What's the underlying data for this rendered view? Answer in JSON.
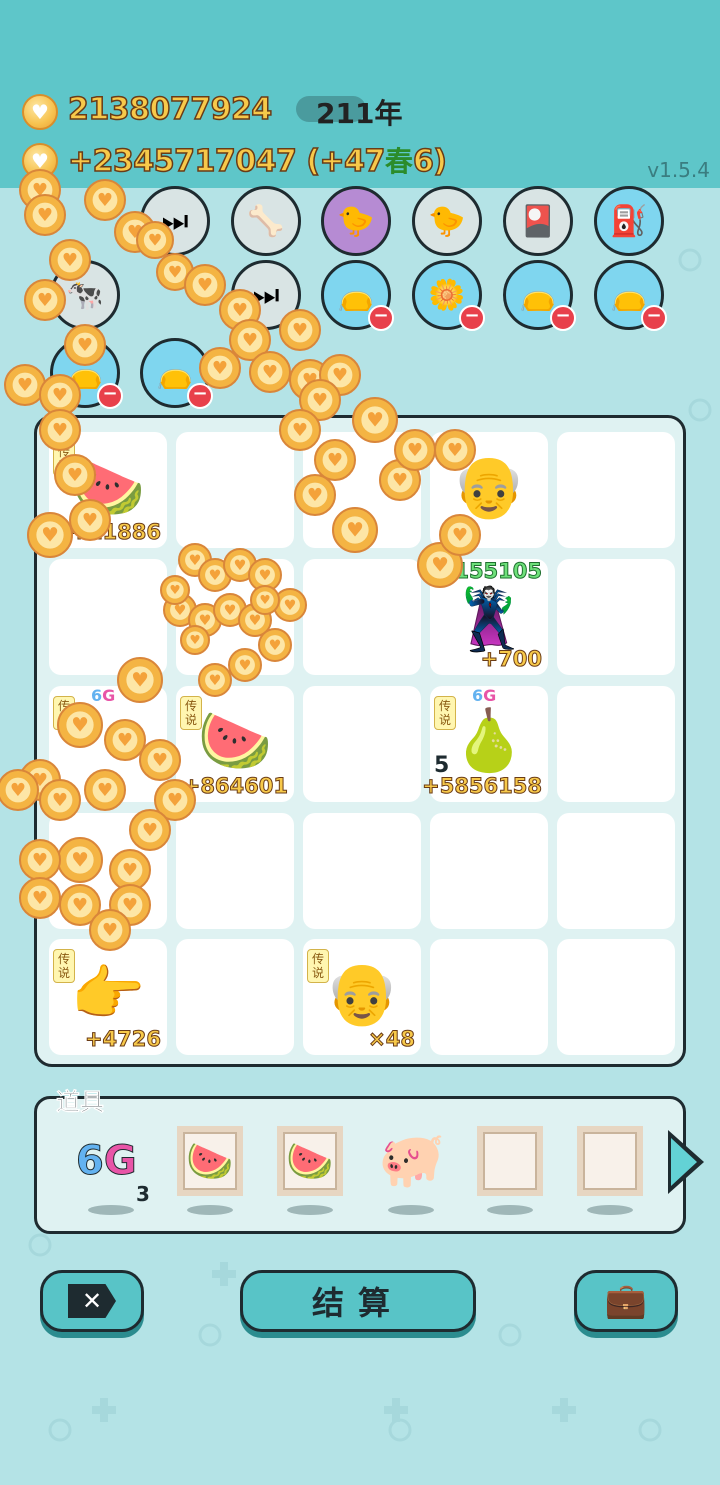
{
  "header": {
    "money": "2138077924",
    "income": "+2345717047 (+47",
    "income_tail": "6)",
    "year": "211年",
    "season": "春",
    "version": "v1.5.4"
  },
  "top_items": [
    {
      "icon": "pump-icon",
      "glyph": "⇡"
    },
    {
      "icon": "seed-bag-icon",
      "glyph": "▣"
    }
  ],
  "board": {
    "cells": [
      {
        "name": "cell-watermelon-1",
        "tag": "传说",
        "value": "+11886",
        "glyph": "🍉"
      },
      {
        "name": "cell-farmer",
        "value": "",
        "glyph": "👴"
      },
      {
        "name": "cell-thief",
        "value": "+700",
        "glyph": "🦹"
      },
      {
        "name": "cell-green-value",
        "value": "155105"
      },
      {
        "name": "cell-watermelon-2",
        "tag": "传说",
        "value": "+864601",
        "glyph": "🍉"
      },
      {
        "name": "cell-ginseng",
        "tag": "传说",
        "badge": "6G",
        "count": "5",
        "value": "+5856158",
        "glyph": "🍐"
      },
      {
        "name": "cell-finger",
        "tag": "传说",
        "value": "+4726",
        "glyph": "👉"
      },
      {
        "name": "cell-grandpa",
        "tag": "传说",
        "value": "×48",
        "glyph": "👴"
      },
      {
        "name": "cell-6g-left",
        "badge": "6G"
      }
    ]
  },
  "props": {
    "title": "道具",
    "count_6g": "3",
    "label_6": "6",
    "label_g": "G"
  },
  "buttons": {
    "settle": "结算"
  },
  "colors": {
    "accent": "#58c4c7",
    "coin": "#f7c94a",
    "outline": "#1e2b30"
  }
}
